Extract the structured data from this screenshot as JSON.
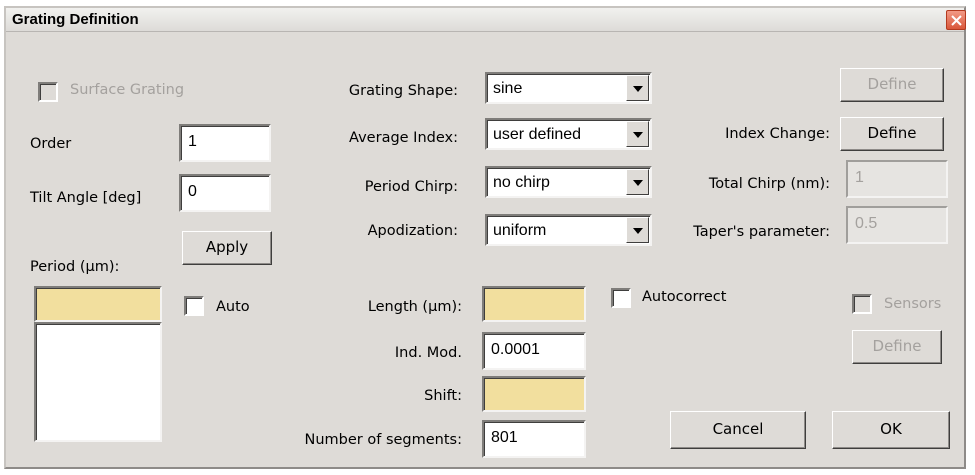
{
  "window": {
    "title": "Grating Definition"
  },
  "left": {
    "surface_grating_label": "Surface Grating",
    "order_label": "Order",
    "order_value": "1",
    "tilt_label": "Tilt Angle [deg]",
    "tilt_value": "0",
    "apply_label": "Apply",
    "period_label": "Period (µm):",
    "auto_label": "Auto"
  },
  "center": {
    "grating_shape_label": "Grating Shape:",
    "grating_shape_value": "sine",
    "average_index_label": "Average Index:",
    "average_index_value": "user defined",
    "period_chirp_label": "Period Chirp:",
    "period_chirp_value": "no chirp",
    "apodization_label": "Apodization:",
    "apodization_value": "uniform",
    "length_label": "Length (µm):",
    "autocorrect_label": "Autocorrect",
    "ind_mod_label": "Ind. Mod.",
    "ind_mod_value": "0.0001",
    "shift_label": "Shift:",
    "segments_label": "Number of segments:",
    "segments_value": "801"
  },
  "right": {
    "define_top_label": "Define",
    "index_change_label": "Index Change:",
    "index_change_define_label": "Define",
    "total_chirp_label": "Total Chirp (nm):",
    "total_chirp_value": "1",
    "taper_label": "Taper's parameter:",
    "taper_value": "0.5",
    "sensors_label": "Sensors",
    "sensors_define_label": "Define",
    "cancel_label": "Cancel",
    "ok_label": "OK"
  },
  "icons": {
    "close": "close-icon",
    "dropdown": "chevron-down-icon"
  },
  "colors": {
    "highlight_field": "#f2df9e",
    "dialog_bg": "#dedbd7",
    "close_button": "#d9573a"
  }
}
